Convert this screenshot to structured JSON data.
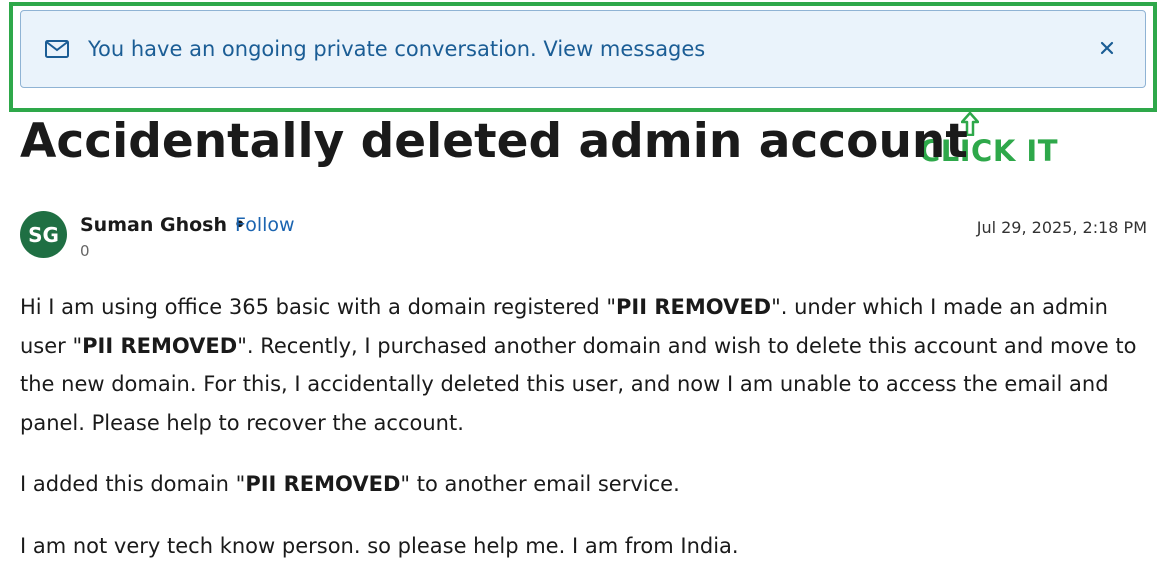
{
  "banner": {
    "message": "You have an ongoing private conversation.",
    "link_text": "View messages",
    "icon": "mail-icon",
    "close_icon": "close-icon"
  },
  "annotation": {
    "label": "CLICK IT",
    "color": "#2ea84a"
  },
  "post": {
    "title": "Accidentally deleted admin account",
    "author": {
      "initials": "SG",
      "name": "Suman Ghosh",
      "separator": "•",
      "follow_label": "Follow",
      "score": "0"
    },
    "date": "Jul 29, 2025, 2:18 PM",
    "body": {
      "p1": [
        "Hi I am using office 365 basic with a domain registered \"",
        "PII REMOVED",
        "\". under which I made an admin user \"",
        "PII REMOVED",
        "\". Recently, I purchased another domain and wish to delete this account and move to the new domain. For this, I accidentally deleted this user, and now I am unable to access the email and panel. Please help to recover the account."
      ],
      "p2": [
        "I added this domain \"",
        "PII REMOVED",
        "\" to another email service."
      ],
      "p3": "I am not very tech know person. so please help me. I am from India."
    }
  },
  "colors": {
    "banner_bg": "#eaf3fb",
    "banner_text": "#1b5d95",
    "link": "#1b64b0",
    "avatar_bg": "#1f6f43"
  }
}
